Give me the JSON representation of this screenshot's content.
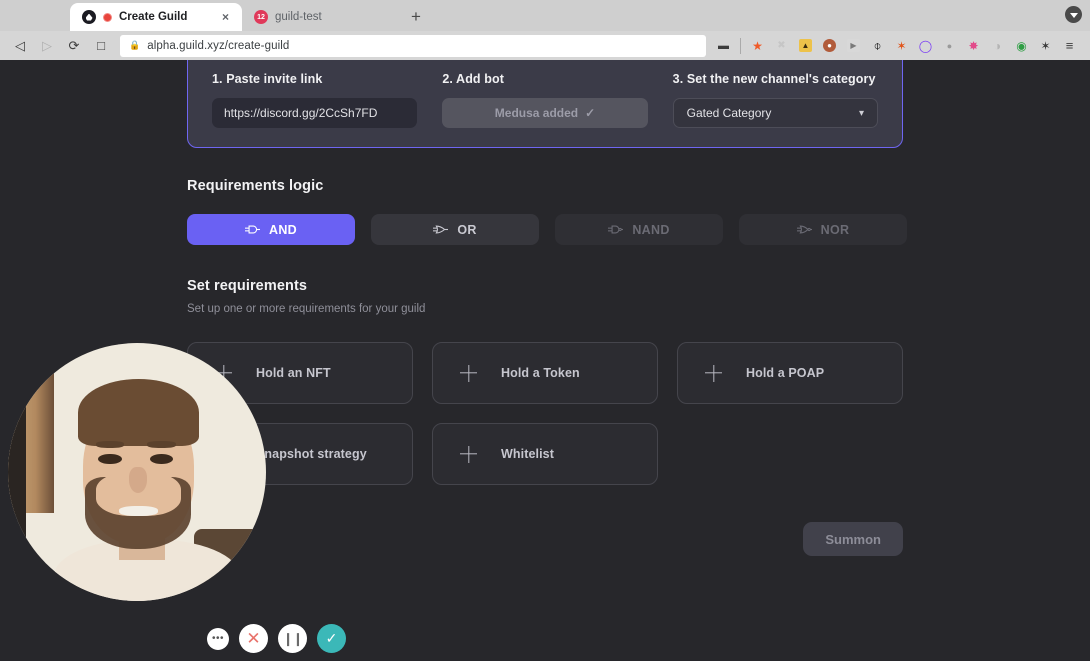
{
  "browser": {
    "tabs": [
      {
        "title": "Create Guild",
        "favicon": "guild-logo-icon",
        "recording": true,
        "active": true,
        "close_label": "×"
      },
      {
        "title": "guild-test",
        "favicon": "discord-icon",
        "recording": false,
        "active": false,
        "close_label": ""
      }
    ],
    "new_tab_label": "+",
    "nav": {
      "back": "◁",
      "forward": "▷",
      "reload": "⟳",
      "bookmark": "□"
    },
    "omnibox": {
      "url": "alpha.guild.xyz/create-guild",
      "lock": "🔒"
    },
    "toolbar_icons": [
      {
        "name": "camera-icon",
        "glyph": "▬",
        "color": "#3c3c3c"
      },
      {
        "name": "brave-shield-icon",
        "glyph": "▼",
        "color": "#f05a28"
      },
      {
        "name": "puzzle-muted-icon",
        "glyph": "✖",
        "color": "#c6c6c6"
      },
      {
        "name": "metamask-icon",
        "glyph": "▲",
        "color": "#e2761b"
      },
      {
        "name": "avatar-extension-icon",
        "glyph": "●",
        "color": "#b15b3a"
      },
      {
        "name": "play-extension-icon",
        "glyph": "▶",
        "color": "#9a9a9a"
      },
      {
        "name": "opera-extension-icon",
        "glyph": "⊝",
        "color": "#1b1b1b"
      },
      {
        "name": "fox-extension-icon",
        "glyph": "✶",
        "color": "#e1561c"
      },
      {
        "name": "ring-extension-icon",
        "glyph": "◯",
        "color": "#7a3df5"
      },
      {
        "name": "wallet-extension-icon",
        "glyph": "●",
        "color": "#8c8c8c"
      },
      {
        "name": "flower-extension-icon",
        "glyph": "✸",
        "color": "#e24a8a"
      },
      {
        "name": "moon-extension-icon",
        "glyph": "◑",
        "color": "#b4b4b4"
      },
      {
        "name": "color-wheel-icon",
        "glyph": "◉",
        "color": "#2f9e44"
      },
      {
        "name": "extensions-puzzle-icon",
        "glyph": "✦",
        "color": "#3c3c3c"
      },
      {
        "name": "menu-icon",
        "glyph": "≡",
        "color": "#3c3c3c"
      }
    ],
    "window_control": "download-caret-icon"
  },
  "setup": {
    "steps": [
      {
        "label": "1. Paste invite link",
        "type": "input",
        "value": "https://discord.gg/2CcSh7FD",
        "name": "invite-link-input"
      },
      {
        "label": "2. Add bot",
        "type": "button",
        "value": "Medusa added",
        "check": "✓",
        "name": "add-bot-button"
      },
      {
        "label": "3. Set the new channel's category",
        "type": "select",
        "value": "Gated Category",
        "chevron": "⌄",
        "name": "category-select"
      }
    ]
  },
  "logic": {
    "title": "Requirements logic",
    "options": [
      {
        "label": "AND",
        "state": "active",
        "icon": "and-gate-icon"
      },
      {
        "label": "OR",
        "state": "idle",
        "icon": "or-gate-icon"
      },
      {
        "label": "NAND",
        "state": "dim",
        "icon": "nand-gate-icon"
      },
      {
        "label": "NOR",
        "state": "dim",
        "icon": "nor-gate-icon"
      }
    ]
  },
  "requirements": {
    "title": "Set requirements",
    "subtitle": "Set up one or more requirements for your guild",
    "cards": [
      {
        "label": "Hold an NFT",
        "plus": true,
        "name": "add-nft-requirement-card"
      },
      {
        "label": "Hold a Token",
        "plus": true,
        "name": "add-token-requirement-card"
      },
      {
        "label": "Hold a POAP",
        "plus": true,
        "name": "add-poap-requirement-card"
      },
      {
        "label": "Snapshot strategy",
        "plus": true,
        "name": "add-snapshot-requirement-card"
      },
      {
        "label": "Whitelist",
        "plus": true,
        "name": "add-whitelist-requirement-card"
      }
    ]
  },
  "submit": {
    "label": "Summon"
  },
  "recorder": {
    "buttons": [
      {
        "name": "more-options-button",
        "glyph": "•••",
        "style": "more"
      },
      {
        "name": "cancel-recording-button",
        "glyph": "✕",
        "style": "close"
      },
      {
        "name": "pause-recording-button",
        "glyph": "❙❙",
        "style": "pause"
      },
      {
        "name": "finish-recording-button",
        "glyph": "✓",
        "style": "done"
      }
    ],
    "webcam_label": "webcam-bubble"
  },
  "colors": {
    "accent": "#6a61f3",
    "card_border": "#6f66f2",
    "page_bg": "#27272b",
    "done_button": "#3bb8b8"
  }
}
